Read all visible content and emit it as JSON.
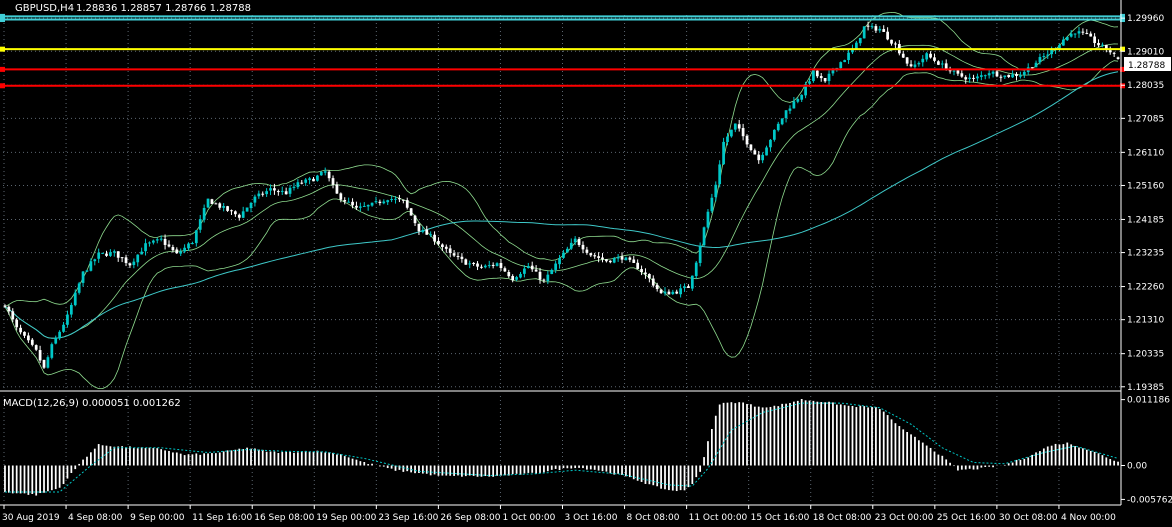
{
  "header": {
    "symbol": "GBPUSD,H4",
    "ohlc": "1.28836 1.28857 1.28766 1.28788",
    "macd_title": "MACD(12,26,9) 0.000051 0.001262"
  },
  "current_price_label": "1.28788",
  "colors": {
    "background": "#000000",
    "grid": "#5c6670",
    "bull": "#00c8c8",
    "bear": "#ffffff",
    "bands": "#8fdc8f",
    "ma_long": "#3ec8c8",
    "cyan_lines": "#40d0d8",
    "yellow_line": "#ffff00",
    "red_lines": "#ff0000",
    "macd_hist": "#ffffff",
    "macd_signal": "#00c8c8"
  },
  "chart_data": [
    {
      "type": "candlestick",
      "title": "GBPUSD,H4",
      "price_axis_labels": [
        "1.29960",
        "1.29010",
        "1.28035",
        "1.27085",
        "1.26110",
        "1.25160",
        "1.24185",
        "1.23235",
        "1.22260",
        "1.21310",
        "1.20335",
        "1.19385"
      ],
      "time_axis_labels": [
        "30 Aug 2019",
        "4 Sep 08:00",
        "9 Sep 00:00",
        "11 Sep 16:00",
        "16 Sep 08:00",
        "19 Sep 00:00",
        "23 Sep 16:00",
        "26 Sep 08:00",
        "1 Oct 00:00",
        "3 Oct 16:00",
        "8 Oct 08:00",
        "11 Oct 00:00",
        "15 Oct 16:00",
        "18 Oct 08:00",
        "23 Oct 00:00",
        "25 Oct 16:00",
        "30 Oct 08:00",
        "4 Nov 00:00"
      ],
      "ylim": [
        1.1935,
        1.3005
      ],
      "grid": true,
      "horizontal_lines": [
        {
          "price": 1.3001,
          "color": "cyan"
        },
        {
          "price": 1.2992,
          "color": "cyan"
        },
        {
          "price": 1.2907,
          "color": "yellow"
        },
        {
          "price": 1.2849,
          "color": "red"
        },
        {
          "price": 1.2802,
          "color": "red"
        }
      ],
      "close_anchors": [
        [
          0,
          1.2175
        ],
        [
          3,
          1.2105
        ],
        [
          8,
          1.204
        ],
        [
          10,
          1.199
        ],
        [
          12,
          1.2055
        ],
        [
          16,
          1.214
        ],
        [
          20,
          1.2265
        ],
        [
          24,
          1.2318
        ],
        [
          28,
          1.2322
        ],
        [
          32,
          1.229
        ],
        [
          36,
          1.2345
        ],
        [
          40,
          1.236
        ],
        [
          44,
          1.2318
        ],
        [
          48,
          1.2355
        ],
        [
          52,
          1.2475
        ],
        [
          56,
          1.245
        ],
        [
          60,
          1.2428
        ],
        [
          64,
          1.248
        ],
        [
          68,
          1.2505
        ],
        [
          72,
          1.2495
        ],
        [
          75,
          1.252
        ],
        [
          79,
          1.2535
        ],
        [
          82,
          1.2555
        ],
        [
          85,
          1.249
        ],
        [
          88,
          1.2465
        ],
        [
          90,
          1.2448
        ],
        [
          94,
          1.246
        ],
        [
          98,
          1.248
        ],
        [
          102,
          1.247
        ],
        [
          106,
          1.239
        ],
        [
          110,
          1.2362
        ],
        [
          114,
          1.2318
        ],
        [
          118,
          1.2295
        ],
        [
          122,
          1.228
        ],
        [
          126,
          1.2292
        ],
        [
          130,
          1.225
        ],
        [
          134,
          1.2285
        ],
        [
          138,
          1.224
        ],
        [
          142,
          1.2305
        ],
        [
          146,
          1.236
        ],
        [
          150,
          1.2318
        ],
        [
          154,
          1.23
        ],
        [
          158,
          1.231
        ],
        [
          162,
          1.2282
        ],
        [
          165,
          1.2248
        ],
        [
          168,
          1.2205
        ],
        [
          172,
          1.2212
        ],
        [
          175,
          1.2225
        ],
        [
          177,
          1.23
        ],
        [
          180,
          1.244
        ],
        [
          182,
          1.252
        ],
        [
          184,
          1.264
        ],
        [
          187,
          1.269
        ],
        [
          190,
          1.264
        ],
        [
          193,
          1.259
        ],
        [
          196,
          1.265
        ],
        [
          200,
          1.273
        ],
        [
          204,
          1.278
        ],
        [
          207,
          1.284
        ],
        [
          210,
          1.281
        ],
        [
          212,
          1.285
        ],
        [
          215,
          1.288
        ],
        [
          218,
          1.292
        ],
        [
          220,
          1.297
        ],
        [
          224,
          1.2965
        ],
        [
          228,
          1.2918
        ],
        [
          232,
          1.2852
        ],
        [
          236,
          1.289
        ],
        [
          240,
          1.286
        ],
        [
          244,
          1.2832
        ],
        [
          248,
          1.282
        ],
        [
          252,
          1.2842
        ],
        [
          256,
          1.283
        ],
        [
          260,
          1.2835
        ],
        [
          264,
          1.287
        ],
        [
          268,
          1.2902
        ],
        [
          271,
          1.2935
        ],
        [
          274,
          1.2958
        ],
        [
          277,
          1.2945
        ],
        [
          280,
          1.292
        ],
        [
          283,
          1.29
        ],
        [
          285,
          1.2879
        ]
      ]
    },
    {
      "type": "histogram",
      "title": "MACD(12,26,9) 0.000051 0.001262",
      "axis_labels": [
        "0.011186",
        "0.00",
        "-0.005762"
      ],
      "ylim": [
        -0.0062,
        0.0118
      ],
      "hist_anchors": [
        [
          0,
          -0.0045
        ],
        [
          8,
          -0.005
        ],
        [
          14,
          -0.0038
        ],
        [
          20,
          0.001
        ],
        [
          24,
          0.0035
        ],
        [
          28,
          0.0033
        ],
        [
          34,
          0.003
        ],
        [
          40,
          0.0028
        ],
        [
          46,
          0.0018
        ],
        [
          52,
          0.002
        ],
        [
          56,
          0.0023
        ],
        [
          62,
          0.003
        ],
        [
          68,
          0.0023
        ],
        [
          72,
          0.0022
        ],
        [
          78,
          0.0025
        ],
        [
          82,
          0.0023
        ],
        [
          86,
          0.0019
        ],
        [
          92,
          0.0005
        ],
        [
          100,
          -0.0008
        ],
        [
          106,
          -0.0013
        ],
        [
          112,
          -0.0018
        ],
        [
          118,
          -0.0018
        ],
        [
          124,
          -0.0019
        ],
        [
          130,
          -0.0016
        ],
        [
          136,
          -0.0013
        ],
        [
          140,
          -0.0008
        ],
        [
          146,
          -0.0003
        ],
        [
          152,
          -0.0008
        ],
        [
          158,
          -0.0017
        ],
        [
          162,
          -0.0025
        ],
        [
          166,
          -0.0035
        ],
        [
          170,
          -0.0042
        ],
        [
          174,
          -0.0043
        ],
        [
          176,
          -0.003
        ],
        [
          178,
          -0.001
        ],
        [
          180,
          0.004
        ],
        [
          183,
          0.0105
        ],
        [
          188,
          0.0108
        ],
        [
          192,
          0.0101
        ],
        [
          196,
          0.0099
        ],
        [
          200,
          0.0105
        ],
        [
          204,
          0.0112
        ],
        [
          210,
          0.0108
        ],
        [
          216,
          0.0101
        ],
        [
          220,
          0.01
        ],
        [
          224,
          0.0097
        ],
        [
          230,
          0.006
        ],
        [
          236,
          0.0035
        ],
        [
          240,
          0.0015
        ],
        [
          244,
          -0.0008
        ],
        [
          250,
          -0.0005
        ],
        [
          256,
          0.0001
        ],
        [
          262,
          0.0015
        ],
        [
          268,
          0.0035
        ],
        [
          272,
          0.0038
        ],
        [
          276,
          0.003
        ],
        [
          280,
          0.002
        ],
        [
          285,
          0.0006
        ]
      ],
      "signal_anchors": [
        [
          0,
          -0.0045
        ],
        [
          14,
          -0.0045
        ],
        [
          22,
          0.0
        ],
        [
          28,
          0.003
        ],
        [
          40,
          0.003
        ],
        [
          52,
          0.0022
        ],
        [
          62,
          0.0027
        ],
        [
          72,
          0.0024
        ],
        [
          82,
          0.0023
        ],
        [
          92,
          0.0012
        ],
        [
          106,
          -0.001
        ],
        [
          124,
          -0.0017
        ],
        [
          136,
          -0.0014
        ],
        [
          146,
          -0.0008
        ],
        [
          158,
          -0.0015
        ],
        [
          170,
          -0.0033
        ],
        [
          176,
          -0.0035
        ],
        [
          180,
          -0.0005
        ],
        [
          186,
          0.006
        ],
        [
          194,
          0.009
        ],
        [
          204,
          0.0106
        ],
        [
          214,
          0.0106
        ],
        [
          224,
          0.0098
        ],
        [
          232,
          0.007
        ],
        [
          240,
          0.003
        ],
        [
          248,
          0.0005
        ],
        [
          256,
          0.0003
        ],
        [
          266,
          0.0022
        ],
        [
          274,
          0.0033
        ],
        [
          285,
          0.0012
        ]
      ]
    }
  ]
}
